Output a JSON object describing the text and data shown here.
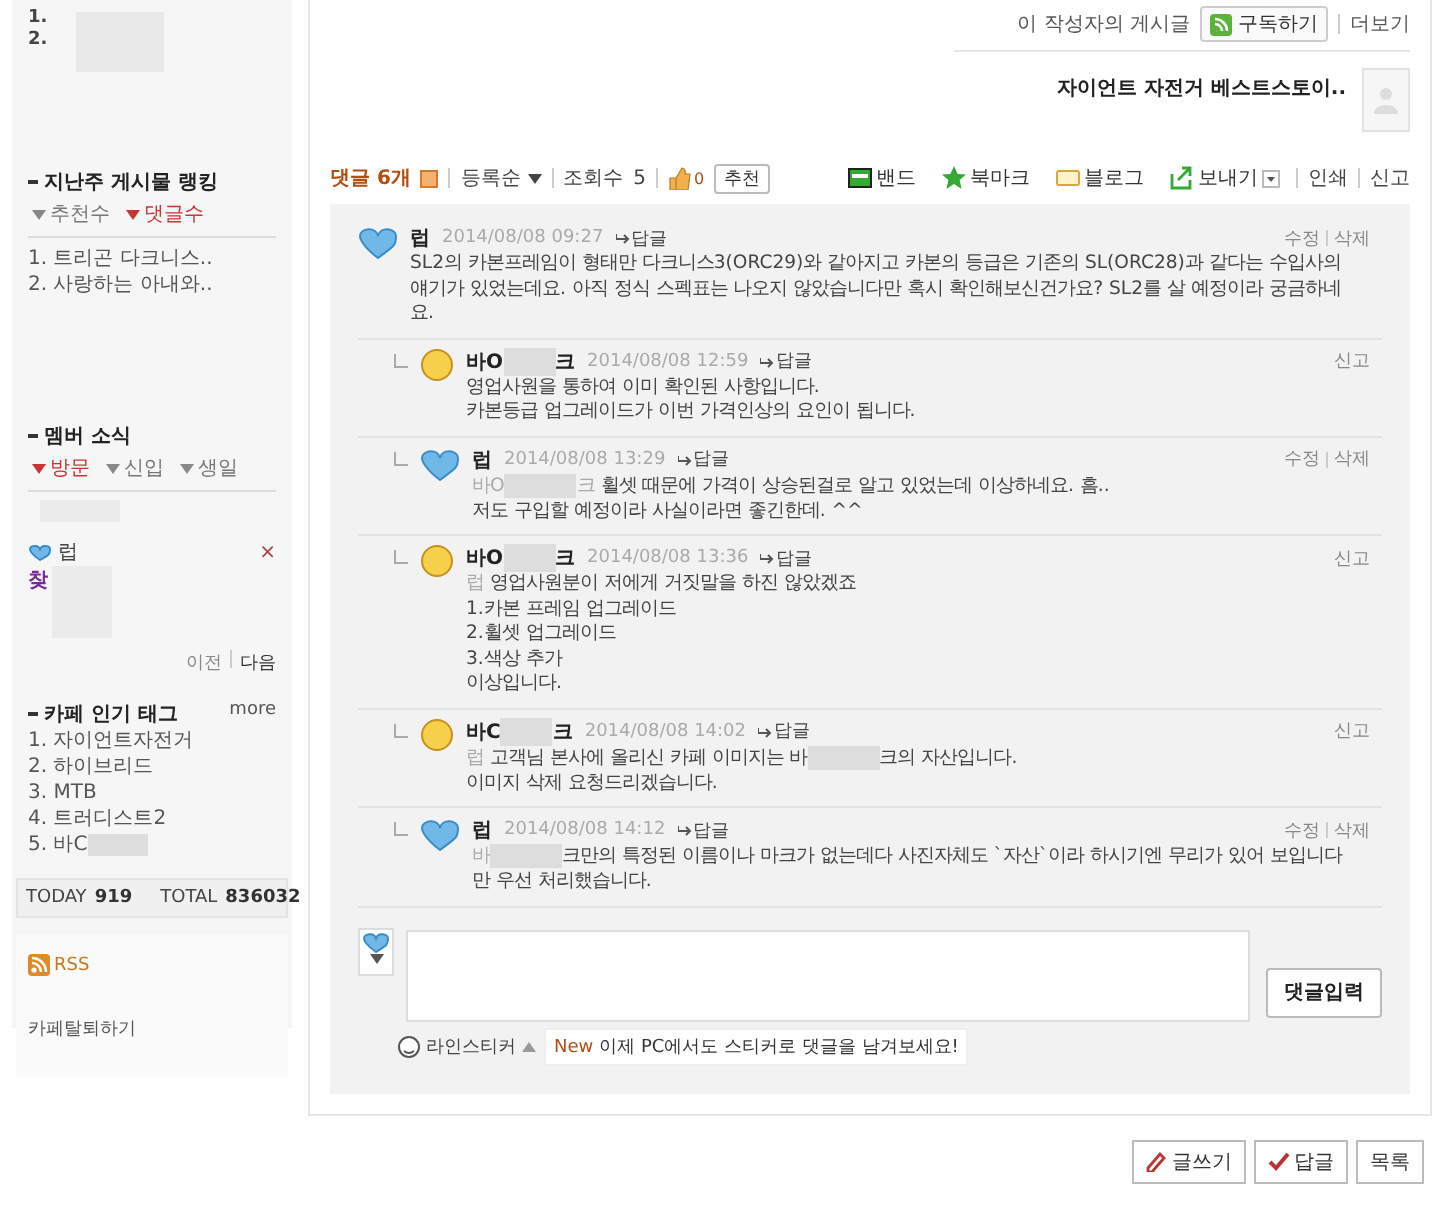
{
  "sidebar": {
    "top_list": {
      "numbers": [
        "1.",
        "2."
      ]
    },
    "ranking": {
      "title": "지난주 게시물 랭킹",
      "tabs": [
        {
          "label": "추천수",
          "selected": false
        },
        {
          "label": "댓글수",
          "selected": true
        }
      ],
      "items": [
        "1. 트리곤 다크니스..",
        "2. 사랑하는 아내와.."
      ]
    },
    "members": {
      "title": "멤버 소식",
      "tabs": [
        {
          "label": "방문",
          "selected": true
        },
        {
          "label": "신입",
          "selected": false
        },
        {
          "label": "생일",
          "selected": false
        }
      ],
      "member": {
        "name": "럽",
        "remove": "×",
        "badge": "찾"
      },
      "pager": [
        "이전",
        "다음"
      ]
    },
    "tags": {
      "title": "카페 인기 태그",
      "more": "more",
      "items": [
        [
          {
            "kind": "text",
            "text": "1. 자이언트자전거"
          }
        ],
        [
          {
            "kind": "text",
            "text": "2. 하이브리드"
          }
        ],
        [
          {
            "kind": "text",
            "text": "3. MTB"
          }
        ],
        [
          {
            "kind": "text",
            "text": "4. 트러디스트2"
          }
        ],
        [
          {
            "kind": "text",
            "text": "5. 바C"
          },
          {
            "kind": "redacted"
          }
        ]
      ]
    },
    "stats": [
      {
        "label": "TODAY",
        "value": "919"
      },
      {
        "label": "TOTAL",
        "value": "836032"
      }
    ],
    "rss": "RSS",
    "leave": "카페탈퇴하기"
  },
  "author_bar": {
    "label": "이 작성자의 게시글",
    "subscribe": "구독하기",
    "more": "더보기",
    "post_title": "자이언트 자전거 베스트스토이.."
  },
  "toolbar": {
    "comments": "댓글 6개",
    "sort": "등록순",
    "views_label": "조회수",
    "views": "5",
    "likes": "0",
    "recommend": "추천",
    "share": [
      {
        "kind": "band",
        "label": "밴드"
      },
      {
        "kind": "bookmark",
        "label": "북마크"
      },
      {
        "kind": "blog",
        "label": "블로그"
      },
      {
        "kind": "send",
        "label": "보내기"
      }
    ],
    "links": [
      "인쇄",
      "신고"
    ]
  },
  "comments": [
    {
      "kind": "comment",
      "avatar": {
        "kind": "heart"
      },
      "author": [
        {
          "kind": "text",
          "text": "럽"
        }
      ],
      "date": "2014/08/08 09:27",
      "reply": "답글",
      "actions": [
        "수정",
        "삭제"
      ],
      "lines": [
        [
          {
            "kind": "text",
            "text": "SL2의 카본프레임이 형태만 다크니스3(ORC29)와 같아지고 카본의 등급은 기존의 SL(ORC28)과 같다는 수입사의 얘기가 있었는데요. 아직 정식 스펙표는 나오지 않았습니다만 혹시 확인해보신건가요? SL2를 살 예정이라 궁금하네요."
          }
        ]
      ]
    },
    {
      "kind": "reply",
      "avatar": {
        "kind": "face"
      },
      "author": [
        {
          "kind": "text",
          "text": "바O"
        },
        {
          "kind": "redacted"
        },
        {
          "kind": "text",
          "text": "크"
        }
      ],
      "date": "2014/08/08 12:59",
      "reply": "답글",
      "actions": [
        "신고"
      ],
      "lines": [
        [
          {
            "kind": "text",
            "text": "영업사원을 통하여 이미 확인된 사항입니다."
          }
        ],
        [
          {
            "kind": "text",
            "text": "카본등급 업그레이드가 이번 가격인상의 요인이 됩니다."
          }
        ]
      ]
    },
    {
      "kind": "reply",
      "avatar": {
        "kind": "heart"
      },
      "author": [
        {
          "kind": "text",
          "text": "럽"
        }
      ],
      "date": "2014/08/08 13:29",
      "reply": "답글",
      "actions": [
        "수정",
        "삭제"
      ],
      "lines": [
        [
          {
            "kind": "mention",
            "text": "바O"
          },
          {
            "kind": "redacted"
          },
          {
            "kind": "mention",
            "text": "크"
          },
          {
            "kind": "text",
            "text": " 휠셋 때문에 가격이 상승된걸로 알고 있었는데 이상하네요. 흠.."
          }
        ],
        [
          {
            "kind": "text",
            "text": "저도 구입할 예정이라 사실이라면 좋긴한데. ^^"
          }
        ]
      ]
    },
    {
      "kind": "reply",
      "avatar": {
        "kind": "face"
      },
      "author": [
        {
          "kind": "text",
          "text": "바O"
        },
        {
          "kind": "redacted"
        },
        {
          "kind": "text",
          "text": "크"
        }
      ],
      "date": "2014/08/08 13:36",
      "reply": "답글",
      "actions": [
        "신고"
      ],
      "lines": [
        [
          {
            "kind": "mention",
            "text": "럽"
          },
          {
            "kind": "text",
            "text": " 영업사원분이 저에게 거짓말을 하진 않았겠죠"
          }
        ],
        [
          {
            "kind": "text",
            "text": "1.카본 프레임 업그레이드"
          }
        ],
        [
          {
            "kind": "text",
            "text": "2.휠셋 업그레이드"
          }
        ],
        [
          {
            "kind": "text",
            "text": "3.색상 추가"
          }
        ],
        [
          {
            "kind": "text",
            "text": "이상입니다."
          }
        ]
      ]
    },
    {
      "kind": "reply",
      "avatar": {
        "kind": "face"
      },
      "author": [
        {
          "kind": "text",
          "text": "바C"
        },
        {
          "kind": "redacted"
        },
        {
          "kind": "text",
          "text": "크"
        }
      ],
      "date": "2014/08/08 14:02",
      "reply": "답글",
      "actions": [
        "신고"
      ],
      "lines": [
        [
          {
            "kind": "mention",
            "text": "럽"
          },
          {
            "kind": "text",
            "text": " 고객님 본사에 올리신 카페 이미지는 바"
          },
          {
            "kind": "redacted"
          },
          {
            "kind": "text",
            "text": "크의 자산입니다."
          }
        ],
        [
          {
            "kind": "text",
            "text": "이미지 삭제 요청드리겠습니다."
          }
        ]
      ]
    },
    {
      "kind": "reply",
      "avatar": {
        "kind": "heart"
      },
      "author": [
        {
          "kind": "text",
          "text": "럽"
        }
      ],
      "date": "2014/08/08 14:12",
      "reply": "답글",
      "actions": [
        "수정",
        "삭제"
      ],
      "lines": [
        [
          {
            "kind": "mention",
            "text": "바"
          },
          {
            "kind": "redacted"
          },
          {
            "kind": "text",
            "text": "크만의 특정된 이름이나 마크가 없는데다 사진자체도 `자산`이라 하시기엔 무리가 있어 보입니다만 우선 처리했습니다."
          }
        ]
      ]
    }
  ],
  "composer": {
    "submit": "댓글입력",
    "sticker": "라인스티커",
    "notice_badge": "New",
    "notice": "이제 PC에서도 스티커로 댓글을 남겨보세요!"
  },
  "buttons": [
    {
      "kind": "write",
      "label": "글쓰기"
    },
    {
      "kind": "reply",
      "label": "답글"
    },
    {
      "kind": "list",
      "label": "목록"
    }
  ]
}
